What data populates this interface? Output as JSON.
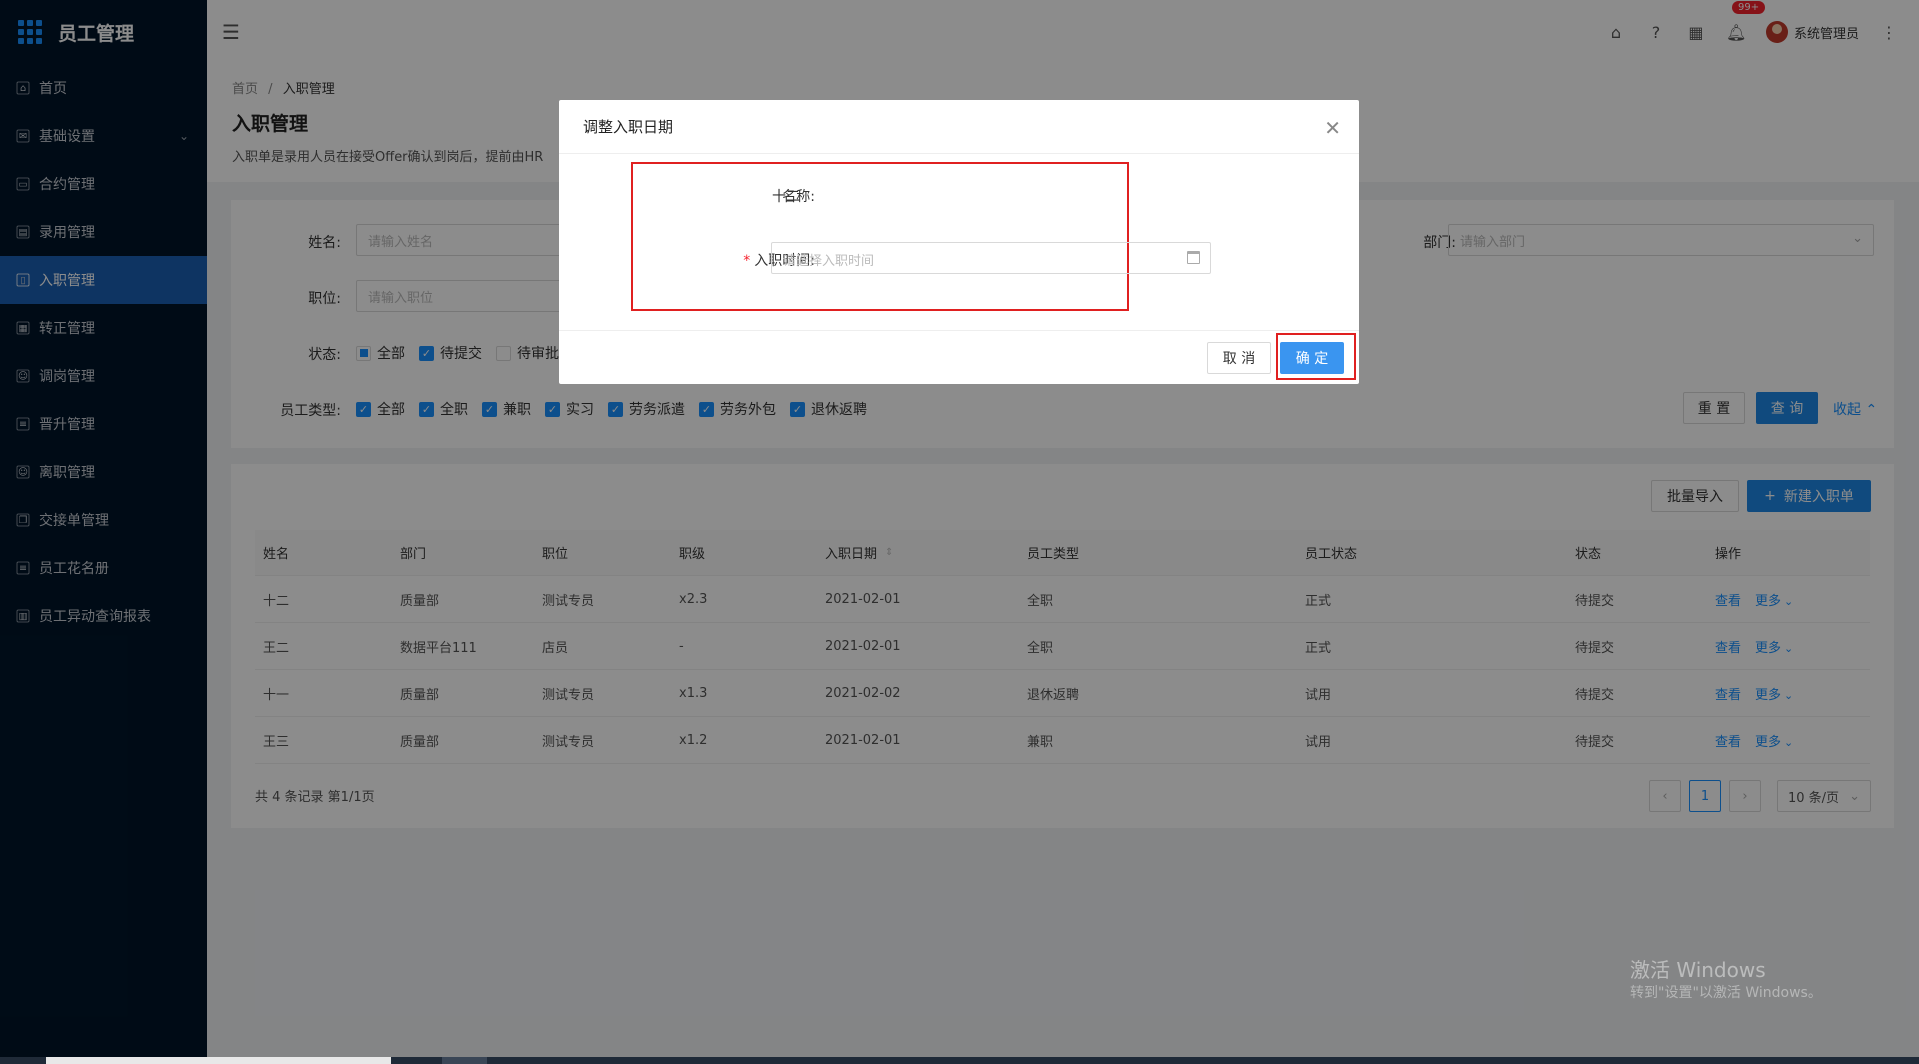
{
  "app": {
    "title": "员工管理"
  },
  "sidebar": {
    "items": [
      {
        "label": "首页",
        "icon": "home-icon"
      },
      {
        "label": "基础设置",
        "icon": "mail-icon"
      },
      {
        "label": "合约管理",
        "icon": "calendar-icon"
      },
      {
        "label": "录用管理",
        "icon": "book-icon"
      },
      {
        "label": "入职管理",
        "icon": "file-icon",
        "active": true
      },
      {
        "label": "转正管理",
        "icon": "grid-icon"
      },
      {
        "label": "调岗管理",
        "icon": "user-icon"
      },
      {
        "label": "晋升管理",
        "icon": "doc-icon"
      },
      {
        "label": "离职管理",
        "icon": "user-out-icon"
      },
      {
        "label": "交接单管理",
        "icon": "copy-icon"
      },
      {
        "label": "员工花名册",
        "icon": "doc-icon"
      },
      {
        "label": "员工异动查询报表",
        "icon": "report-icon"
      }
    ]
  },
  "topbar": {
    "badge": "99+",
    "user_name": "系统管理员"
  },
  "page": {
    "breadcrumb_home": "首页",
    "breadcrumb_sep": "/",
    "breadcrumb_current": "入职管理",
    "title": "入职管理",
    "description": "入职单是录用人员在接受Offer确认到岗后，提前由HR"
  },
  "filters": {
    "name_label": "姓名:",
    "name_placeholder": "请输入姓名",
    "dept_label": "部门:",
    "dept_placeholder": "请输入部门",
    "position_label": "职位:",
    "position_placeholder": "请输入职位",
    "status_label": "状态:",
    "status_options": [
      "全部",
      "待提交",
      "待审批"
    ],
    "emp_type_label": "员工类型:",
    "emp_type_options": [
      "全部",
      "全职",
      "兼职",
      "实习",
      "劳务派遣",
      "劳务外包",
      "退休返聘"
    ],
    "reset_label": "重 置",
    "search_label": "查 询",
    "collapse_label": "收起"
  },
  "table": {
    "batch_import_label": "批量导入",
    "new_label": "新建入职单",
    "headers": [
      "姓名",
      "部门",
      "职位",
      "职级",
      "入职日期",
      "员工类型",
      "员工状态",
      "状态",
      "操作"
    ],
    "rows": [
      [
        "十二",
        "质量部",
        "测试专员",
        "x2.3",
        "2021-02-01",
        "全职",
        "正式",
        "待提交"
      ],
      [
        "王二",
        "数据平台111",
        "店员",
        "-",
        "2021-02-01",
        "全职",
        "正式",
        "待提交"
      ],
      [
        "十一",
        "质量部",
        "测试专员",
        "x1.3",
        "2021-02-02",
        "退休返聘",
        "试用",
        "待提交"
      ],
      [
        "王三",
        "质量部",
        "测试专员",
        "x1.2",
        "2021-02-01",
        "兼职",
        "试用",
        "待提交"
      ]
    ],
    "action_view": "查看",
    "action_more": "更多",
    "total_text": "共 4 条记录 第1/1页",
    "current_page": "1",
    "page_size": "10 条/页"
  },
  "modal": {
    "title": "调整入职日期",
    "name_label": "名称:",
    "name_value": "十二",
    "date_label": "入职时间:",
    "date_placeholder": "请选择入职时间",
    "cancel_label": "取 消",
    "ok_label": "确 定"
  },
  "watermark": {
    "line1": "激活 Windows",
    "line2": "转到\"设置\"以激活 Windows。"
  },
  "colors": {
    "sidebar_bg": "#001529",
    "active_bg": "#1b5fb2",
    "primary": "#1890ff",
    "highlight": "#e02020"
  }
}
